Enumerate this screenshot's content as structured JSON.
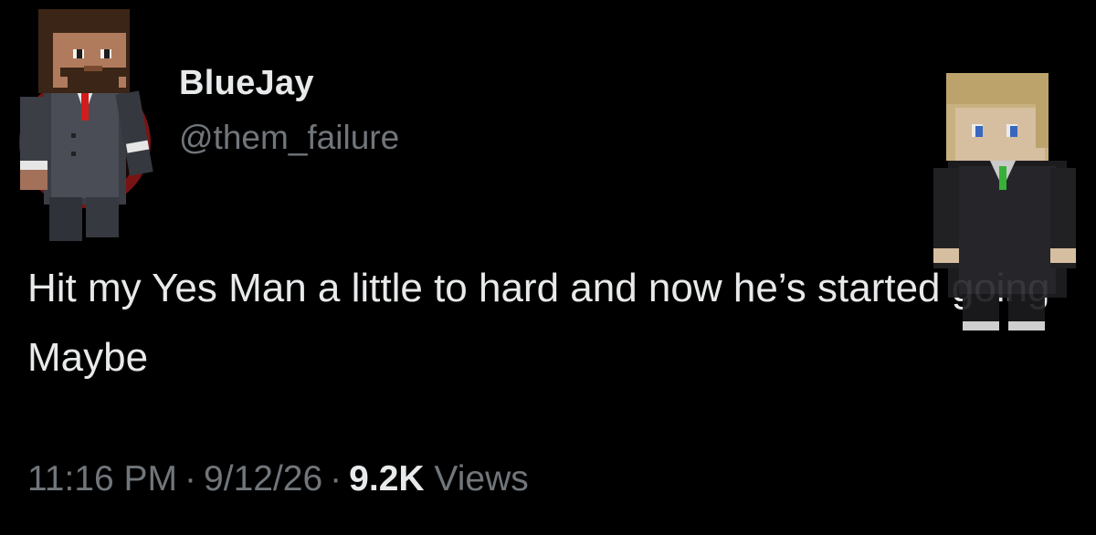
{
  "author": {
    "display_name": "BlueJay",
    "handle": "@them_failure",
    "avatar_icon": "minecraft-character-suit-avatar"
  },
  "tweet": {
    "text": "Hit my Yes Man a little to hard and now he’s started going Maybe",
    "sticker_icon": "minecraft-blonde-character-suit-sticker"
  },
  "meta": {
    "time": "11:16 PM",
    "separator": "·",
    "date": "9/12/26",
    "views_count": "9.2K",
    "views_label": "Views"
  },
  "colors": {
    "background": "#000000",
    "primary_text": "#e7e9ea",
    "secondary_text": "#71767b",
    "avatar_ring": "#8b1a1a"
  }
}
